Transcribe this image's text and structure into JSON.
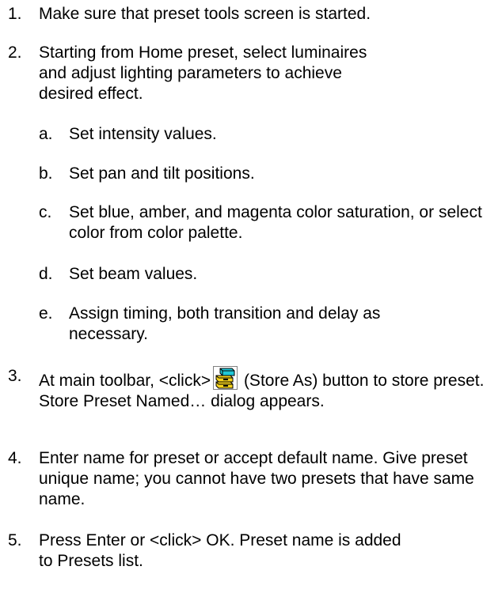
{
  "steps": [
    {
      "num": "1.",
      "text": "Make sure that preset tools screen is started."
    },
    {
      "num": "2.",
      "text": "Starting from Home preset, select luminaires and adjust lighting parameters to achieve desired effect."
    },
    {
      "num": "3.",
      "text_before_icon": "At main toolbar, <click>",
      "text_after_icon": " (Store As) button to store preset. Store Preset Named… dialog appears.",
      "icon": "store-as-icon"
    },
    {
      "num": "4.",
      "text": "Enter name for preset or accept default name. Give preset unique name; you cannot have two presets that have same name."
    },
    {
      "num": "5.",
      "text": "Press Enter or <click> OK. Preset name is added to Presets list."
    }
  ],
  "substeps": [
    {
      "num": "a.",
      "text": "Set intensity values."
    },
    {
      "num": "b.",
      "text": "Set pan and tilt positions."
    },
    {
      "num": "c.",
      "text": "Set blue, amber, and magenta color saturation, or select color from color palette."
    },
    {
      "num": "d.",
      "text": "Set beam values."
    },
    {
      "num": "e.",
      "text": "Assign timing, both transition and delay as necessary."
    }
  ],
  "colors": {
    "text": "#000000",
    "icon_yellow": "#f5d21c",
    "icon_cyan": "#20c8d8"
  }
}
